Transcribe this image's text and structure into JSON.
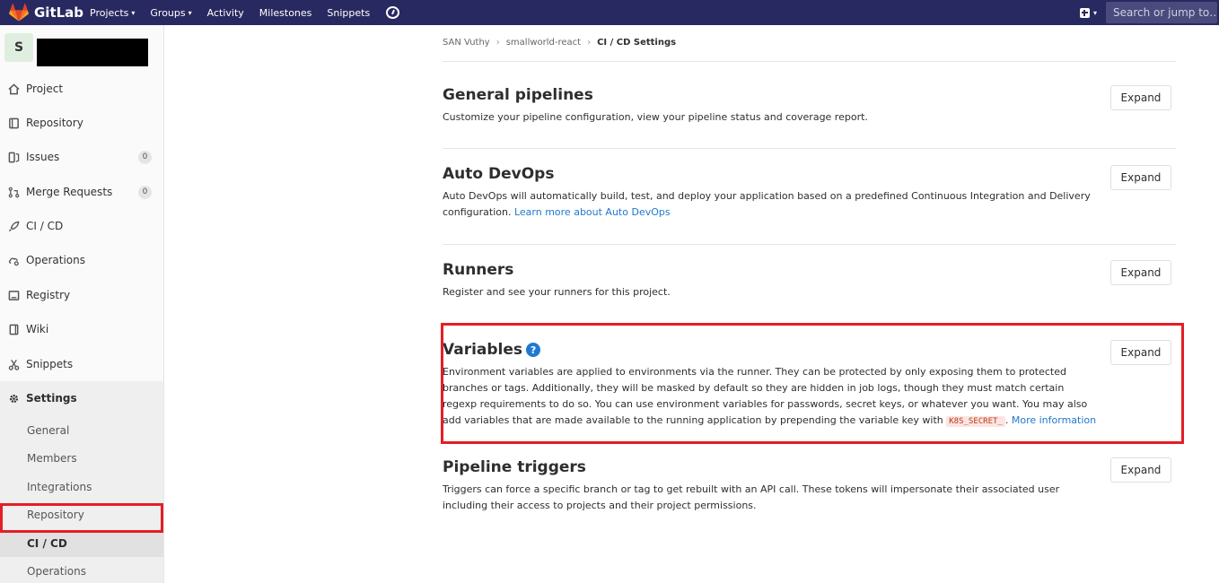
{
  "topbar": {
    "brand": "GitLab",
    "nav": [
      {
        "label": "Projects",
        "caret": true
      },
      {
        "label": "Groups",
        "caret": true
      },
      {
        "label": "Activity",
        "caret": false
      },
      {
        "label": "Milestones",
        "caret": false
      },
      {
        "label": "Snippets",
        "caret": false
      }
    ],
    "search_placeholder": "Search or jump to…",
    "colors": {
      "navbar": "#292961",
      "logo": "#e24329"
    }
  },
  "sidebar": {
    "project_avatar": "S",
    "items": [
      {
        "label": "Project",
        "icon": "home-icon"
      },
      {
        "label": "Repository",
        "icon": "book-icon"
      },
      {
        "label": "Issues",
        "icon": "issues-icon",
        "count": "0"
      },
      {
        "label": "Merge Requests",
        "icon": "merge-request-icon",
        "count": "0"
      },
      {
        "label": "CI / CD",
        "icon": "rocket-icon"
      },
      {
        "label": "Operations",
        "icon": "cloud-gear-icon"
      },
      {
        "label": "Registry",
        "icon": "container-icon"
      },
      {
        "label": "Wiki",
        "icon": "wiki-icon"
      },
      {
        "label": "Snippets",
        "icon": "scissors-icon"
      },
      {
        "label": "Settings",
        "icon": "gear-icon",
        "active": true
      }
    ],
    "settings_sub": [
      "General",
      "Members",
      "Integrations",
      "Repository",
      "CI / CD",
      "Operations"
    ],
    "current_sub": "CI / CD"
  },
  "breadcrumb": [
    "SAN Vuthy",
    "smallworld-react",
    "CI / CD Settings"
  ],
  "sections": [
    {
      "title": "General pipelines",
      "desc": "Customize your pipeline configuration, view your pipeline status and coverage report.",
      "button": "Expand"
    },
    {
      "title": "Auto DevOps",
      "desc": "Auto DevOps will automatically build, test, and deploy your application based on a predefined Continuous Integration and Delivery configuration.",
      "link": "Learn more about Auto DevOps",
      "button": "Expand"
    },
    {
      "title": "Runners",
      "desc": "Register and see your runners for this project.",
      "button": "Expand"
    },
    {
      "title": "Variables",
      "help": "?",
      "desc": "Environment variables are applied to environments via the runner. They can be protected by only exposing them to protected branches or tags. Additionally, they will be masked by default so they are hidden in job logs, though they must match certain regexp requirements to do so. You can use environment variables for passwords, secret keys, or whatever you want. You may also add variables that are made available to the running application by prepending the variable key with",
      "code": "K8S_SECRET_",
      "after_code": ".",
      "link": "More information",
      "button": "Expand"
    },
    {
      "title": "Pipeline triggers",
      "desc": "Triggers can force a specific branch or tag to get rebuilt with an API call. These tokens will impersonate their associated user including their access to projects and their project permissions.",
      "button": "Expand"
    }
  ],
  "highlight_color": "#e41e26"
}
